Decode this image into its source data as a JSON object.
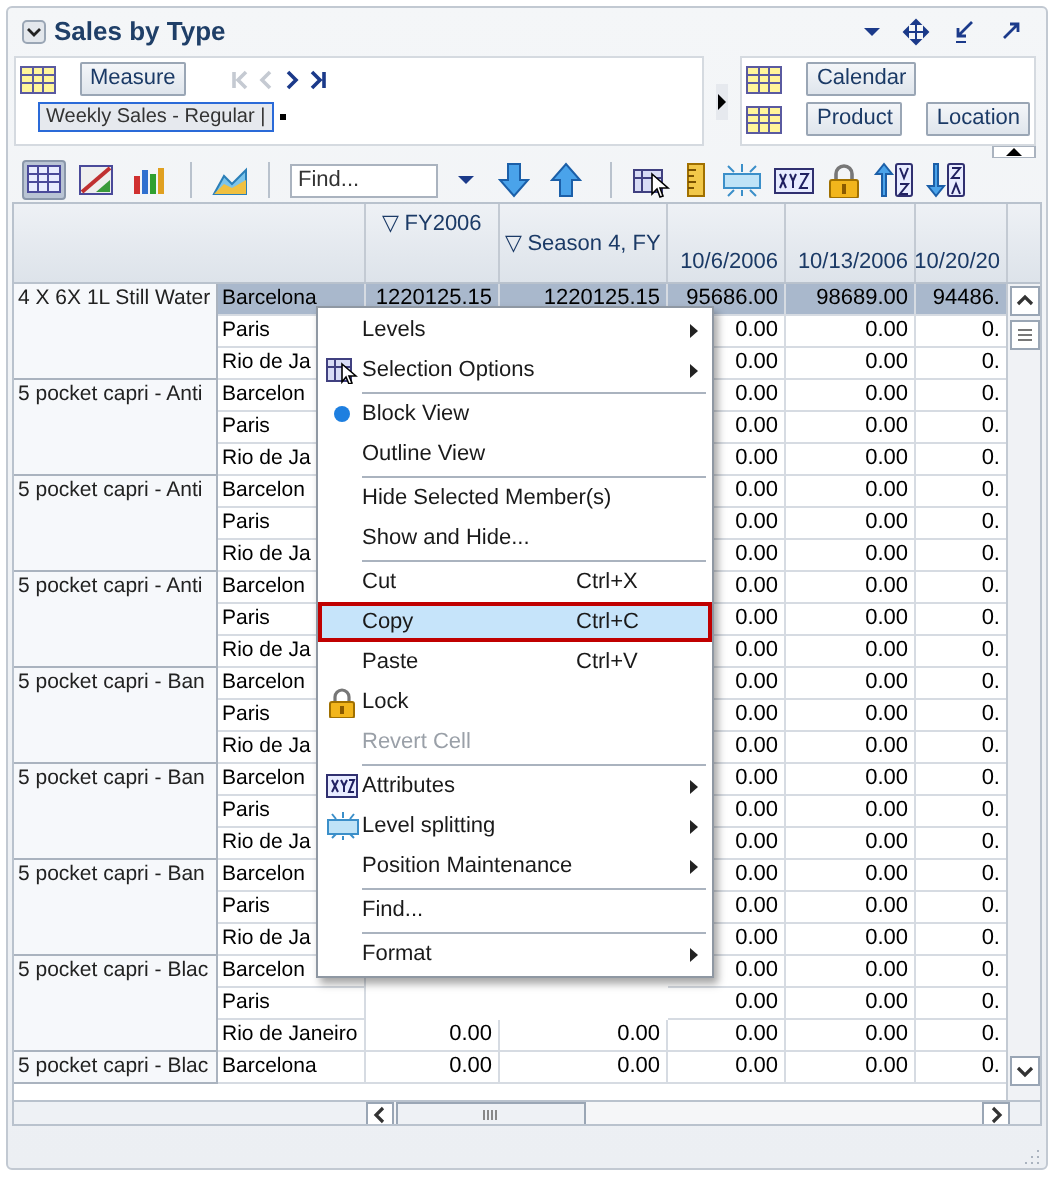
{
  "panel": {
    "title": "Sales by Type"
  },
  "pivot": {
    "rows_button": "Measure",
    "nav": [
      {
        "disabled": true
      },
      {
        "disabled": true
      },
      {
        "disabled": false
      },
      {
        "disabled": false
      }
    ],
    "chip": {
      "label": "Weekly Sales - Regular |",
      "selected": true
    },
    "column_buttons": [
      "Calendar"
    ],
    "row_buttons": [
      "Product",
      "Location"
    ]
  },
  "toolbar": {
    "view_buttons": [
      {
        "selected": true
      },
      {
        "selected": false
      },
      {
        "selected": false
      }
    ],
    "find": {
      "placeholder": "Find..."
    }
  },
  "grid": {
    "columns": [
      {
        "kind": "year",
        "expander": "▽",
        "label": "FY2006"
      },
      {
        "kind": "season",
        "expander": "▽",
        "label": "Season 4, FY"
      },
      {
        "kind": "week",
        "label": "10/6/2006"
      },
      {
        "kind": "week",
        "label": "10/13/2006"
      },
      {
        "kind": "week",
        "label": "10/20/20"
      }
    ],
    "groups": [
      {
        "product": "4 X 6X 1L Still Water",
        "rows": [
          {
            "location": "Barcelona",
            "selected": true,
            "cells": [
              "1220125.15",
              "1220125.15",
              "95686.00",
              "98689.00",
              "94486."
            ]
          },
          {
            "location": "Paris",
            "selected": false,
            "cells": [
              "",
              "",
              "0.00",
              "0.00",
              "0."
            ]
          },
          {
            "location": "Rio de Ja",
            "selected": false,
            "cells": [
              "",
              "",
              "0.00",
              "0.00",
              "0."
            ]
          }
        ]
      },
      {
        "product": "5 pocket capri - Anti",
        "rows": [
          {
            "location": "Barcelon",
            "selected": false,
            "cells": [
              "",
              "",
              "0.00",
              "0.00",
              "0."
            ]
          },
          {
            "location": "Paris",
            "selected": false,
            "cells": [
              "",
              "",
              "0.00",
              "0.00",
              "0."
            ]
          },
          {
            "location": "Rio de Ja",
            "selected": false,
            "cells": [
              "",
              "",
              "0.00",
              "0.00",
              "0."
            ]
          }
        ]
      },
      {
        "product": "5 pocket capri - Anti",
        "rows": [
          {
            "location": "Barcelon",
            "selected": false,
            "cells": [
              "",
              "",
              "0.00",
              "0.00",
              "0."
            ]
          },
          {
            "location": "Paris",
            "selected": false,
            "cells": [
              "",
              "",
              "0.00",
              "0.00",
              "0."
            ]
          },
          {
            "location": "Rio de Ja",
            "selected": false,
            "cells": [
              "",
              "",
              "0.00",
              "0.00",
              "0."
            ]
          }
        ]
      },
      {
        "product": "5 pocket capri - Anti",
        "rows": [
          {
            "location": "Barcelon",
            "selected": false,
            "cells": [
              "",
              "",
              "0.00",
              "0.00",
              "0."
            ]
          },
          {
            "location": "Paris",
            "selected": false,
            "cells": [
              "",
              "",
              "0.00",
              "0.00",
              "0."
            ]
          },
          {
            "location": "Rio de Ja",
            "selected": false,
            "cells": [
              "",
              "",
              "0.00",
              "0.00",
              "0."
            ]
          }
        ]
      },
      {
        "product": "5 pocket capri - Ban",
        "rows": [
          {
            "location": "Barcelon",
            "selected": false,
            "cells": [
              "",
              "",
              "0.00",
              "0.00",
              "0."
            ]
          },
          {
            "location": "Paris",
            "selected": false,
            "cells": [
              "",
              "",
              "0.00",
              "0.00",
              "0."
            ]
          },
          {
            "location": "Rio de Ja",
            "selected": false,
            "cells": [
              "",
              "",
              "0.00",
              "0.00",
              "0."
            ]
          }
        ]
      },
      {
        "product": "5 pocket capri - Ban",
        "rows": [
          {
            "location": "Barcelon",
            "selected": false,
            "cells": [
              "",
              "",
              "0.00",
              "0.00",
              "0."
            ]
          },
          {
            "location": "Paris",
            "selected": false,
            "cells": [
              "",
              "",
              "0.00",
              "0.00",
              "0."
            ]
          },
          {
            "location": "Rio de Ja",
            "selected": false,
            "cells": [
              "",
              "",
              "0.00",
              "0.00",
              "0."
            ]
          }
        ]
      },
      {
        "product": "5 pocket capri - Ban",
        "rows": [
          {
            "location": "Barcelon",
            "selected": false,
            "cells": [
              "",
              "",
              "0.00",
              "0.00",
              "0."
            ]
          },
          {
            "location": "Paris",
            "selected": false,
            "cells": [
              "",
              "",
              "0.00",
              "0.00",
              "0."
            ]
          },
          {
            "location": "Rio de Ja",
            "selected": false,
            "cells": [
              "",
              "",
              "0.00",
              "0.00",
              "0."
            ]
          }
        ]
      },
      {
        "product": "5 pocket capri - Blac",
        "rows": [
          {
            "location": "Barcelon",
            "selected": false,
            "cells": [
              "",
              "",
              "0.00",
              "0.00",
              "0."
            ]
          },
          {
            "location": "Paris",
            "selected": false,
            "cells": [
              "",
              "",
              "0.00",
              "0.00",
              "0."
            ]
          },
          {
            "location": "Rio de Janeiro",
            "selected": false,
            "cells": [
              "0.00",
              "0.00",
              "0.00",
              "0.00",
              "0."
            ]
          }
        ]
      },
      {
        "product": "5 pocket capri - Blac",
        "rows": [
          {
            "location": "Barcelona",
            "selected": false,
            "cells": [
              "0.00",
              "0.00",
              "0.00",
              "0.00",
              "0."
            ]
          }
        ]
      }
    ]
  },
  "context_menu": [
    {
      "kind": "item",
      "label": "Levels",
      "submenu": true,
      "disabled": false,
      "highlighted": false
    },
    {
      "kind": "item",
      "label": "Selection Options",
      "submenu": true,
      "disabled": false,
      "highlighted": false
    },
    {
      "kind": "separator"
    },
    {
      "kind": "radio",
      "label": "Block View",
      "checked": true,
      "submenu": false,
      "disabled": false,
      "highlighted": false
    },
    {
      "kind": "radio",
      "label": "Outline View",
      "checked": false,
      "submenu": false,
      "disabled": false,
      "highlighted": false
    },
    {
      "kind": "separator"
    },
    {
      "kind": "item",
      "label": "Hide Selected Member(s)",
      "submenu": false,
      "disabled": false,
      "highlighted": false
    },
    {
      "kind": "item",
      "label": "Show and Hide...",
      "submenu": false,
      "disabled": false,
      "highlighted": false
    },
    {
      "kind": "separator"
    },
    {
      "kind": "item",
      "label": "Cut",
      "shortcut": "Ctrl+X",
      "submenu": false,
      "disabled": false,
      "highlighted": false
    },
    {
      "kind": "item",
      "label": "Copy",
      "shortcut": "Ctrl+C",
      "submenu": false,
      "disabled": false,
      "highlighted": true
    },
    {
      "kind": "item",
      "label": "Paste",
      "shortcut": "Ctrl+V",
      "submenu": false,
      "disabled": false,
      "highlighted": false
    },
    {
      "kind": "item",
      "label": "Lock",
      "submenu": false,
      "disabled": false,
      "highlighted": false
    },
    {
      "kind": "item",
      "label": "Revert Cell",
      "submenu": false,
      "disabled": true,
      "highlighted": false
    },
    {
      "kind": "separator"
    },
    {
      "kind": "item",
      "label": "Attributes",
      "submenu": true,
      "disabled": false,
      "highlighted": false
    },
    {
      "kind": "item",
      "label": "Level splitting",
      "submenu": true,
      "disabled": false,
      "highlighted": false
    },
    {
      "kind": "item",
      "label": "Position Maintenance",
      "submenu": true,
      "disabled": false,
      "highlighted": false
    },
    {
      "kind": "separator"
    },
    {
      "kind": "item",
      "label": "Find...",
      "submenu": false,
      "disabled": false,
      "highlighted": false
    },
    {
      "kind": "separator"
    },
    {
      "kind": "item",
      "label": "Format",
      "submenu": true,
      "disabled": false,
      "highlighted": false
    }
  ]
}
